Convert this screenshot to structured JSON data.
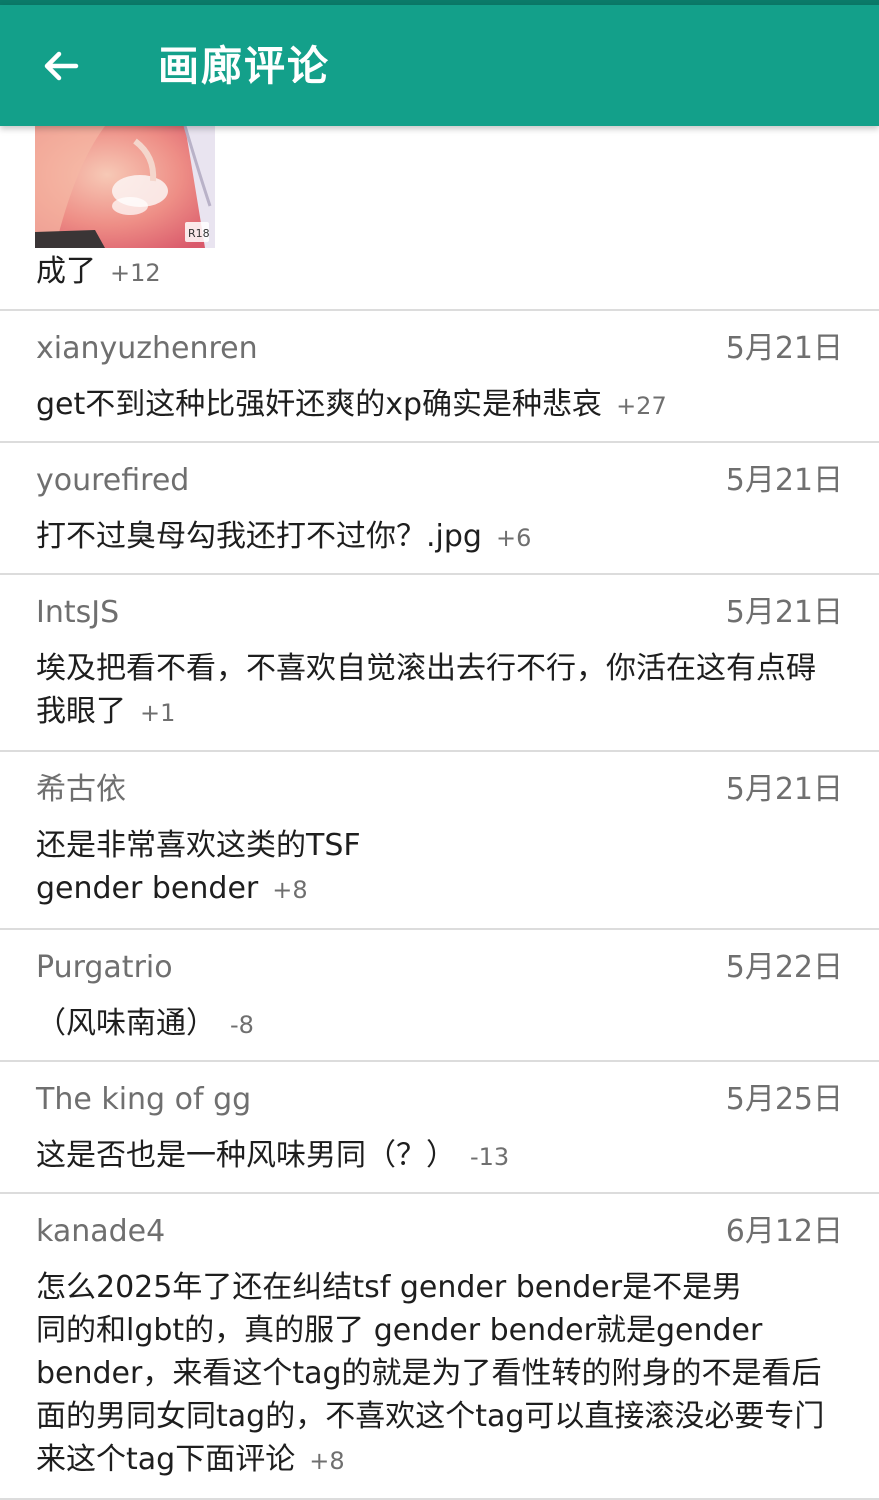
{
  "appbar": {
    "title": "画廊评论"
  },
  "first": {
    "text": "成了",
    "score": "+12"
  },
  "comments": [
    {
      "user": "xianyuzhenren",
      "date": "5月21日",
      "text": "get不到这种比强奸还爽的xp确实是种悲哀",
      "score": "+27"
    },
    {
      "user": "yourefired",
      "date": "5月21日",
      "text": "打不过臭母勾我还打不过你？.jpg",
      "score": "+6"
    },
    {
      "user": "IntsJS",
      "date": "5月21日",
      "text": "埃及把看不看，不喜欢自觉滚出去行不行，你活在这有点碍\n我眼了",
      "score": "+1"
    },
    {
      "user": "希古依",
      "date": "5月21日",
      "text": "还是非常喜欢这类的TSF\ngender bender",
      "score": "+8"
    },
    {
      "user": "Purgatrio",
      "date": "5月22日",
      "text": "（风味南通）",
      "score": "-8"
    },
    {
      "user": "The king of gg",
      "date": "5月25日",
      "text": "这是否也是一种风味男同（？）",
      "score": "-13"
    },
    {
      "user": "kanade4",
      "date": "6月12日",
      "text": "怎么2025年了还在纠结tsf gender bender是不是男\n同的和lgbt的，真的服了 gender bender就是gender\nbender，来看这个tag的就是为了看性转的附身的不是看后\n面的男同女同tag的，不喜欢这个tag可以直接滚没必要专门\n来这个tag下面评论",
      "score": "+8"
    }
  ]
}
